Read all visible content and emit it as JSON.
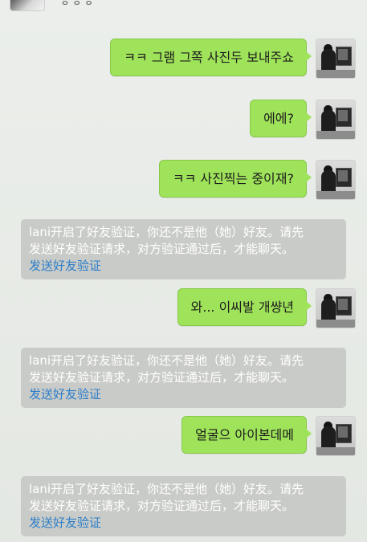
{
  "header_peek": {
    "contact_name": "ㅎㅎㅎ"
  },
  "messages": [
    {
      "type": "sent",
      "text": "ㅋㅋ 그램 그쪽 사진두 보내주쇼"
    },
    {
      "type": "sent",
      "text": "에에?"
    },
    {
      "type": "sent",
      "text": "ㅋㅋ 사진찍는 중이재?"
    },
    {
      "type": "system",
      "line1": "lani开启了好友验证，你还不是他（她）好友。请先",
      "line2": "发送好友验证请求，对方验证通过后，才能聊天。",
      "link": "发送好友验证"
    },
    {
      "type": "sent",
      "text": "와... 이씨발 개썅년"
    },
    {
      "type": "system",
      "line1": "lani开启了好友验证，你还不是他（她）好友。请先",
      "line2": "发送好友验证请求，对方验证通过后，才能聊天。",
      "link": "发送好友验证"
    },
    {
      "type": "sent",
      "text": "얼굴으 아이본데메"
    },
    {
      "type": "system",
      "line1": "lani开启了好友验证，你还不是他（她）好友。请先",
      "line2": "发送好友验证请求，对方验证通过后，才能聊天。",
      "link": "发送好友验证"
    }
  ],
  "colors": {
    "sent_bubble": "#9fe35a",
    "system_notice_bg": "#c9cbc8",
    "link": "#2d7ec9",
    "background": "#e7ebe6"
  },
  "icons": {
    "self_avatar": "avatar-photo-icon"
  }
}
